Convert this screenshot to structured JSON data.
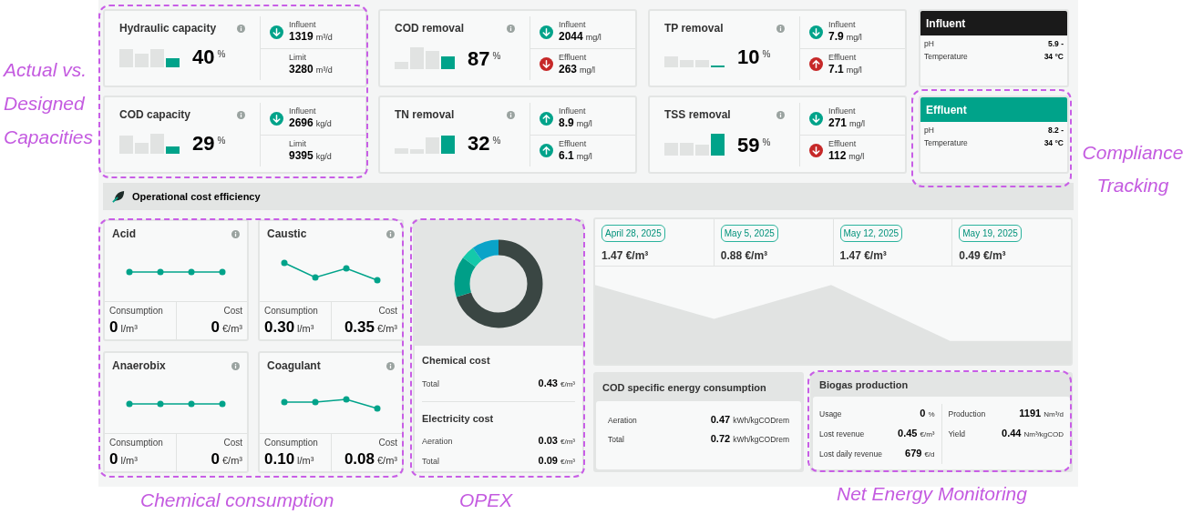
{
  "kpis": [
    {
      "title": "Hydraulic capacity",
      "value": "40",
      "unit": "%",
      "metrics": [
        {
          "label": "Influent",
          "value": "1319",
          "unit": "m³/d",
          "rising": false,
          "alert": false
        },
        {
          "label": "Limit",
          "value": "3280",
          "unit": "m³/d"
        }
      ]
    },
    {
      "title": "COD removal",
      "value": "87",
      "unit": "%",
      "metrics": [
        {
          "label": "Influent",
          "value": "2044",
          "unit": "mg/l",
          "rising": false,
          "alert": false
        },
        {
          "label": "Effluent",
          "value": "263",
          "unit": "mg/l",
          "rising": false,
          "alert": true
        }
      ]
    },
    {
      "title": "TP removal",
      "value": "10",
      "unit": "%",
      "metrics": [
        {
          "label": "Influent",
          "value": "7.9",
          "unit": "mg/l",
          "rising": false,
          "alert": false
        },
        {
          "label": "Effluent",
          "value": "7.1",
          "unit": "mg/l",
          "rising": true,
          "alert": true
        }
      ]
    },
    {
      "title": "COD capacity",
      "value": "29",
      "unit": "%",
      "metrics": [
        {
          "label": "Influent",
          "value": "2696",
          "unit": "kg/d",
          "rising": false,
          "alert": false
        },
        {
          "label": "Limit",
          "value": "9395",
          "unit": "kg/d"
        }
      ]
    },
    {
      "title": "TN removal",
      "value": "32",
      "unit": "%",
      "metrics": [
        {
          "label": "Influent",
          "value": "8.9",
          "unit": "mg/l",
          "rising": true,
          "alert": false
        },
        {
          "label": "Effluent",
          "value": "6.1",
          "unit": "mg/l",
          "rising": true,
          "alert": false
        }
      ]
    },
    {
      "title": "TSS removal",
      "value": "59",
      "unit": "%",
      "metrics": [
        {
          "label": "Influent",
          "value": "271",
          "unit": "mg/l",
          "rising": false,
          "alert": false
        },
        {
          "label": "Effluent",
          "value": "112",
          "unit": "mg/l",
          "rising": false,
          "alert": true
        }
      ]
    }
  ],
  "compliance": [
    {
      "title": "Influent",
      "color": "#1a1a1a",
      "rows": [
        {
          "label": "pH",
          "value": "5.9 -"
        },
        {
          "label": "Temperature",
          "value": "34 °C"
        }
      ]
    },
    {
      "title": "Effluent",
      "color": "#00a38a",
      "rows": [
        {
          "label": "pH",
          "value": "8.2 -"
        },
        {
          "label": "Temperature",
          "value": "34 °C"
        }
      ]
    }
  ],
  "section": {
    "title": "Operational cost efficiency"
  },
  "chemicals": [
    {
      "title": "Acid",
      "consumption_label": "Consumption",
      "consumption": "0",
      "consumption_unit": "l/m³",
      "cost_label": "Cost",
      "cost": "0",
      "cost_unit": "€/m³"
    },
    {
      "title": "Caustic",
      "consumption_label": "Consumption",
      "consumption": "0.30",
      "consumption_unit": "l/m³",
      "cost_label": "Cost",
      "cost": "0.35",
      "cost_unit": "€/m³"
    },
    {
      "title": "Anaerobix",
      "consumption_label": "Consumption",
      "consumption": "0",
      "consumption_unit": "l/m³",
      "cost_label": "Cost",
      "cost": "0",
      "cost_unit": "€/m³"
    },
    {
      "title": "Coagulant",
      "consumption_label": "Consumption",
      "consumption": "0.10",
      "consumption_unit": "l/m³",
      "cost_label": "Cost",
      "cost": "0.08",
      "cost_unit": "€/m³"
    }
  ],
  "opex": {
    "groups": [
      {
        "title": "Chemical cost",
        "rows": [
          {
            "label": "Total",
            "value": "0.43",
            "unit": "€/m³"
          }
        ]
      },
      {
        "title": "Electricity cost",
        "rows": [
          {
            "label": "Aeration",
            "value": "0.03",
            "unit": "€/m³"
          },
          {
            "label": "Total",
            "value": "0.09",
            "unit": "€/m³"
          }
        ]
      }
    ]
  },
  "weeks": [
    {
      "date": "April 28, 2025",
      "value": "1.47 €/m³"
    },
    {
      "date": "May 5, 2025",
      "value": "0.88 €/m³"
    },
    {
      "date": "May 12, 2025",
      "value": "1.47 €/m³"
    },
    {
      "date": "May 19, 2025",
      "value": "0.49 €/m³"
    }
  ],
  "cod_energy": {
    "title": "COD specific energy consumption",
    "rows": [
      {
        "label": "Aeration",
        "value": "0.47",
        "unit": "kWh/kgCODrem"
      },
      {
        "label": "Total",
        "value": "0.72",
        "unit": "kWh/kgCODrem"
      }
    ]
  },
  "biogas": {
    "title": "Biogas production",
    "left": [
      {
        "label": "Usage",
        "value": "0",
        "unit": "%"
      },
      {
        "label": "Lost revenue",
        "value": "0.45",
        "unit": "€/m³"
      },
      {
        "label": "Lost daily revenue",
        "value": "679",
        "unit": "€/d"
      }
    ],
    "right": [
      {
        "label": "Production",
        "value": "1191",
        "unit": "Nm³/d"
      },
      {
        "label": "Yield",
        "value": "0.44",
        "unit": "Nm³/kgCOD"
      }
    ]
  },
  "annotations": [
    "Actual vs. Designed Capacities",
    "Compliance Tracking",
    "Chemical consumption",
    "OPEX",
    "Net Energy Monitoring"
  ]
}
